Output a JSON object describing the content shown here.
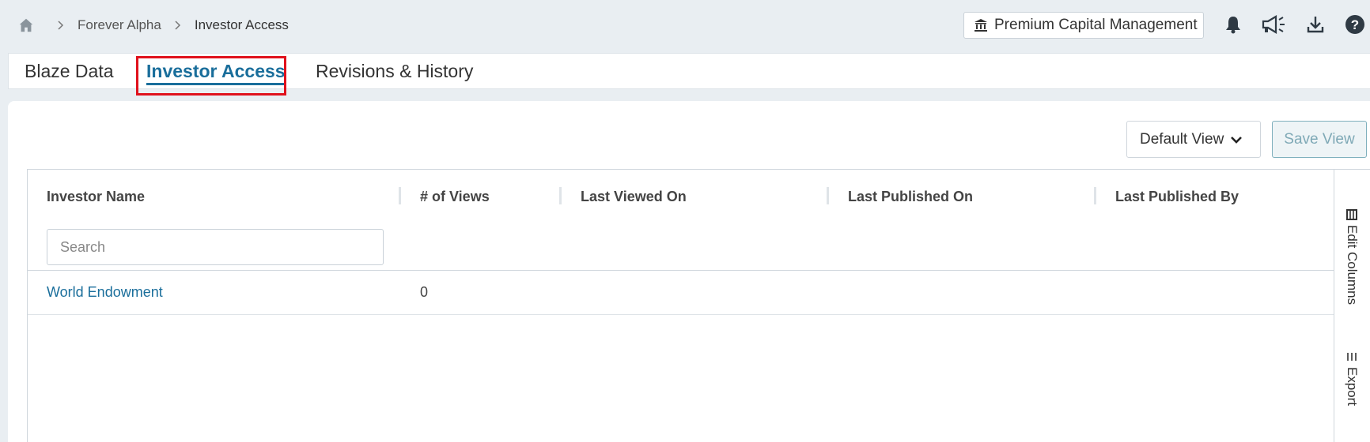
{
  "breadcrumb": {
    "items": [
      "Forever Alpha",
      "Investor Access"
    ]
  },
  "org": {
    "label": "Premium Capital Management"
  },
  "header_icons": [
    "bell-icon",
    "megaphone-icon",
    "download-icon",
    "help-icon"
  ],
  "tabs": [
    {
      "label": "Blaze Data",
      "active": false
    },
    {
      "label": "Investor Access",
      "active": true
    },
    {
      "label": "Revisions & History",
      "active": false
    }
  ],
  "toolbar": {
    "view_select": "Default View",
    "save_label": "Save View"
  },
  "table": {
    "columns": [
      "Investor Name",
      "# of Views",
      "Last Viewed On",
      "Last Published On",
      "Last Published By"
    ],
    "search_placeholder": "Search",
    "rows": [
      {
        "investor_name": "World Endowment",
        "views": "0",
        "last_viewed_on": "",
        "last_published_on": "",
        "last_published_by": ""
      }
    ]
  },
  "side_panel": {
    "edit_columns": "Edit Columns",
    "export": "Export"
  },
  "colors": {
    "accent": "#1a6e9b",
    "highlight": "#e0111c",
    "background": "#e9eef2"
  }
}
